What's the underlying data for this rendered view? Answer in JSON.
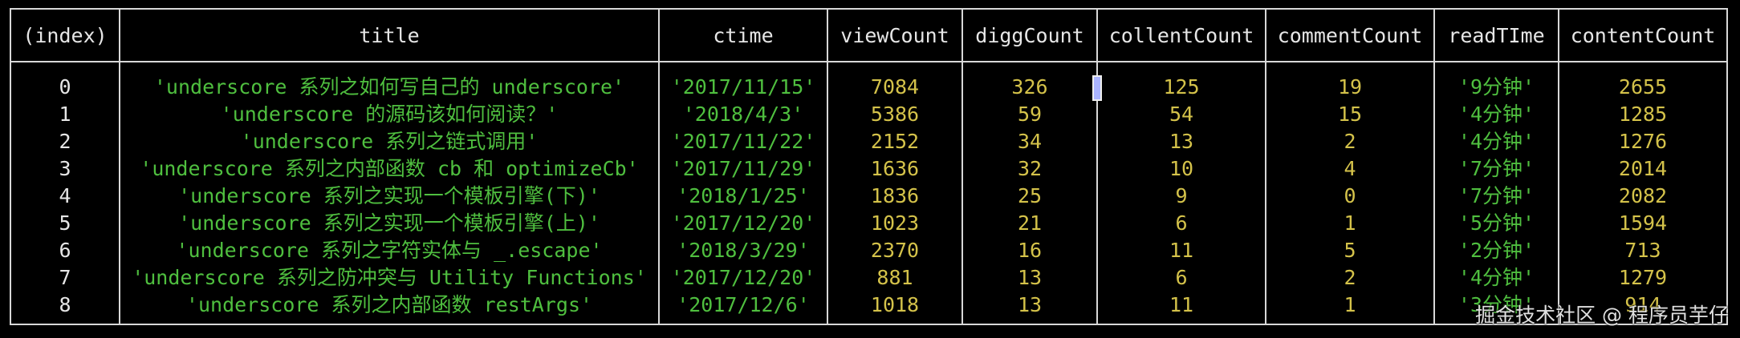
{
  "columns": [
    "(index)",
    "title",
    "ctime",
    "viewCount",
    "diggCount",
    "collentCount",
    "commentCount",
    "readTIme",
    "contentCount"
  ],
  "rows": [
    {
      "index": "0",
      "title": "'underscore 系列之如何写自己的 underscore'",
      "ctime": "'2017/11/15'",
      "viewCount": "7084",
      "diggCount": "326",
      "collentCount": "125",
      "commentCount": "19",
      "readTIme": "'9分钟'",
      "contentCount": "2655"
    },
    {
      "index": "1",
      "title": "'underscore 的源码该如何阅读？'",
      "ctime": "'2018/4/3'",
      "viewCount": "5386",
      "diggCount": "59",
      "collentCount": "54",
      "commentCount": "15",
      "readTIme": "'4分钟'",
      "contentCount": "1285"
    },
    {
      "index": "2",
      "title": "'underscore 系列之链式调用'",
      "ctime": "'2017/11/22'",
      "viewCount": "2152",
      "diggCount": "34",
      "collentCount": "13",
      "commentCount": "2",
      "readTIme": "'4分钟'",
      "contentCount": "1276"
    },
    {
      "index": "3",
      "title": "'underscore 系列之内部函数 cb 和 optimizeCb'",
      "ctime": "'2017/11/29'",
      "viewCount": "1636",
      "diggCount": "32",
      "collentCount": "10",
      "commentCount": "4",
      "readTIme": "'7分钟'",
      "contentCount": "2014"
    },
    {
      "index": "4",
      "title": "'underscore 系列之实现一个模板引擎(下)'",
      "ctime": "'2018/1/25'",
      "viewCount": "1836",
      "diggCount": "25",
      "collentCount": "9",
      "commentCount": "0",
      "readTIme": "'7分钟'",
      "contentCount": "2082"
    },
    {
      "index": "5",
      "title": "'underscore 系列之实现一个模板引擎(上)'",
      "ctime": "'2017/12/20'",
      "viewCount": "1023",
      "diggCount": "21",
      "collentCount": "6",
      "commentCount": "1",
      "readTIme": "'5分钟'",
      "contentCount": "1594"
    },
    {
      "index": "6",
      "title": "'underscore 系列之字符实体与 _.escape'",
      "ctime": "'2018/3/29'",
      "viewCount": "2370",
      "diggCount": "16",
      "collentCount": "11",
      "commentCount": "5",
      "readTIme": "'2分钟'",
      "contentCount": "713"
    },
    {
      "index": "7",
      "title": "'underscore 系列之防冲突与 Utility Functions'",
      "ctime": "'2017/12/20'",
      "viewCount": "881",
      "diggCount": "13",
      "collentCount": "6",
      "commentCount": "2",
      "readTIme": "'4分钟'",
      "contentCount": "1279"
    },
    {
      "index": "8",
      "title": "'underscore 系列之内部函数 restArgs'",
      "ctime": "'2017/12/6'",
      "viewCount": "1018",
      "diggCount": "13",
      "collentCount": "11",
      "commentCount": "1",
      "readTIme": "'3分钟'",
      "contentCount": "914"
    }
  ],
  "watermark": "掘金技术社区 @ 程序员芋仔",
  "colors": {
    "background": "#000000",
    "border": "#d8d8d8",
    "header_text": "#e6e6e6",
    "string_value": "#4fbf3f",
    "number_value": "#d4c24a",
    "cursor": "#aab4ff"
  }
}
